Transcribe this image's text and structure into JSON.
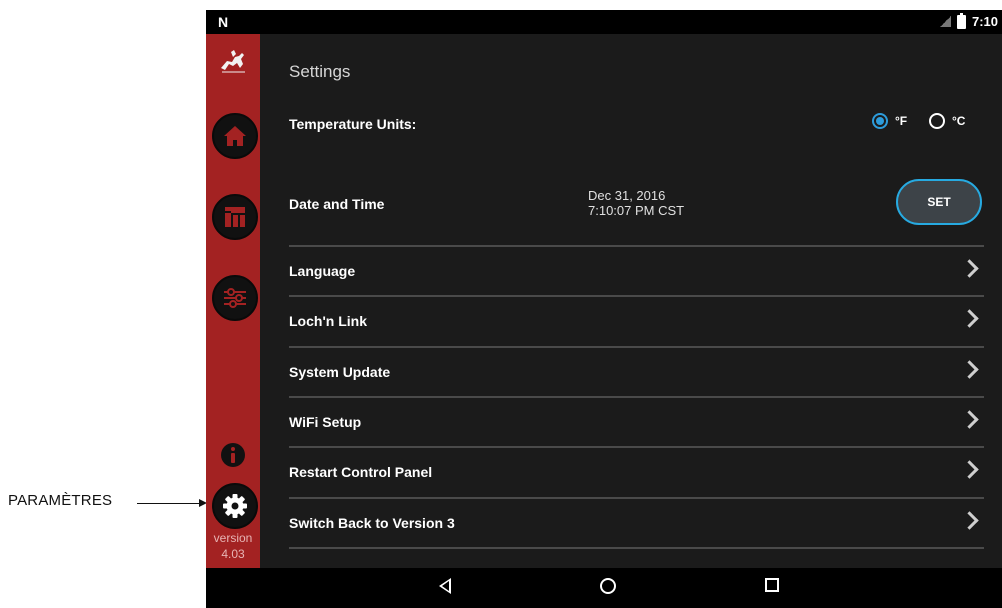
{
  "callout": {
    "label": "PARAMÈTRES"
  },
  "status_bar": {
    "left_icon": "N",
    "time": "7:10"
  },
  "sidebar": {
    "version_label": "version",
    "version_number": "4.03",
    "items": [
      {
        "name": "home",
        "icon": "home-icon"
      },
      {
        "name": "dashboard",
        "icon": "layout-icon"
      },
      {
        "name": "controls",
        "icon": "sliders-icon"
      },
      {
        "name": "info",
        "icon": "info-icon"
      },
      {
        "name": "settings",
        "icon": "gear-icon"
      }
    ],
    "accent_color": "#a32222"
  },
  "settings": {
    "title": "Settings",
    "temperature": {
      "label": "Temperature Units:",
      "options": [
        {
          "label": "°F",
          "selected": true
        },
        {
          "label": "°C",
          "selected": false
        }
      ],
      "selected_color": "#2d9cdb"
    },
    "date_time": {
      "label": "Date and Time",
      "date": "Dec 31, 2016",
      "time": "7:10:07 PM CST",
      "button_label": "SET"
    },
    "rows": [
      {
        "label": "Language"
      },
      {
        "label": "Loch'n Link"
      },
      {
        "label": "System Update"
      },
      {
        "label": "WiFi Setup"
      },
      {
        "label": "Restart Control Panel"
      },
      {
        "label": "Switch Back to Version 3"
      }
    ]
  },
  "nav_bar": {
    "buttons": [
      "back",
      "home",
      "recents"
    ]
  }
}
